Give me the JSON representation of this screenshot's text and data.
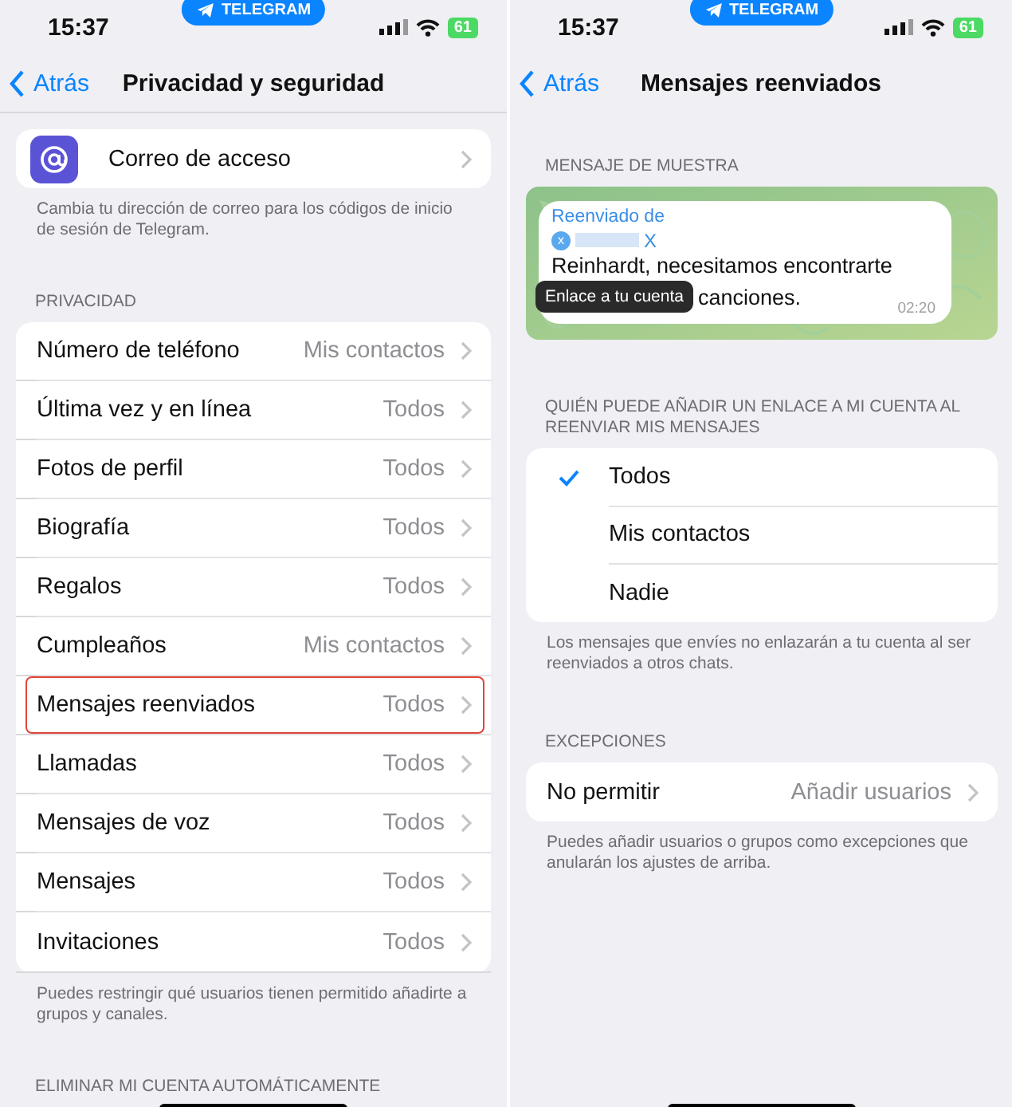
{
  "screens": [
    {
      "status_bar": {
        "time": "15:37",
        "pill": "TELEGRAM",
        "battery": "61"
      },
      "nav": {
        "back": "Atrás",
        "title": "Privacidad y seguridad"
      },
      "sections": [
        {
          "kind": "group",
          "rows": [
            {
              "kind": "nav_icon",
              "label": "Correo de acceso",
              "highlighted": false
            }
          ]
        },
        {
          "kind": "footer",
          "text": "Cambia tu dirección de correo para los códigos de inicio de sesión de Telegram."
        },
        {
          "kind": "header",
          "text": "PRIVACIDAD"
        },
        {
          "kind": "group",
          "rows": [
            {
              "kind": "nav",
              "label": "Número de teléfono",
              "value": "Mis contactos",
              "highlighted": false
            },
            {
              "kind": "nav",
              "label": "Última vez y en línea",
              "value": "Todos",
              "highlighted": false
            },
            {
              "kind": "nav",
              "label": "Fotos de perfil",
              "value": "Todos",
              "highlighted": false
            },
            {
              "kind": "nav",
              "label": "Biografía",
              "value": "Todos",
              "highlighted": false
            },
            {
              "kind": "nav",
              "label": "Regalos",
              "value": "Todos",
              "highlighted": false
            },
            {
              "kind": "nav",
              "label": "Cumpleaños",
              "value": "Mis contactos",
              "highlighted": false
            },
            {
              "kind": "nav",
              "label": "Mensajes reenviados",
              "value": "Todos",
              "highlighted": true
            },
            {
              "kind": "nav",
              "label": "Llamadas",
              "value": "Todos",
              "highlighted": false
            },
            {
              "kind": "nav",
              "label": "Mensajes de voz",
              "value": "Todos",
              "highlighted": false
            },
            {
              "kind": "nav",
              "label": "Mensajes",
              "value": "Todos",
              "highlighted": false
            },
            {
              "kind": "nav",
              "label": "Invitaciones",
              "value": "Todos",
              "highlighted": false
            }
          ]
        },
        {
          "kind": "footer",
          "text": "Puedes restringir qué usuarios tienen permitido añadirte a grupos y canales."
        },
        {
          "kind": "header",
          "text": "ELIMINAR MI CUENTA AUTOMÁTICAMENTE"
        }
      ]
    },
    {
      "status_bar": {
        "time": "15:37",
        "pill": "TELEGRAM",
        "battery": "61"
      },
      "nav": {
        "back": "Atrás",
        "title": "Mensajes reenviados"
      },
      "sections": [
        {
          "kind": "header",
          "text": "MENSAJE DE MUESTRA"
        },
        {
          "kind": "preview",
          "forwarded_label": "Reenviado de",
          "avatar": "x",
          "name": "X",
          "lines": [
            "Reinhardt, necesitamos encontrarte",
            "canciones."
          ],
          "time": "02:20",
          "tooltip": "Enlace a tu cuenta"
        },
        {
          "kind": "header",
          "text": "QUIÉN PUEDE AÑADIR UN ENLACE A MI CUENTA AL REENVIAR MIS MENSAJES"
        },
        {
          "kind": "group",
          "rows": [
            {
              "kind": "option",
              "label": "Todos",
              "selected": true
            },
            {
              "kind": "option",
              "label": "Mis contactos",
              "selected": false
            },
            {
              "kind": "option",
              "label": "Nadie",
              "selected": false
            }
          ]
        },
        {
          "kind": "footer",
          "text": "Los mensajes que envíes no enlazarán a tu cuenta al ser reenviados a otros chats."
        },
        {
          "kind": "header",
          "text": "EXCEPCIONES"
        },
        {
          "kind": "group",
          "rows": [
            {
              "kind": "nav",
              "label": "No permitir",
              "value": "Añadir usuarios",
              "highlighted": false
            }
          ]
        },
        {
          "kind": "footer",
          "text": "Puedes añadir usuarios o grupos como excepciones que anularán los ajustes de arriba."
        }
      ]
    }
  ]
}
